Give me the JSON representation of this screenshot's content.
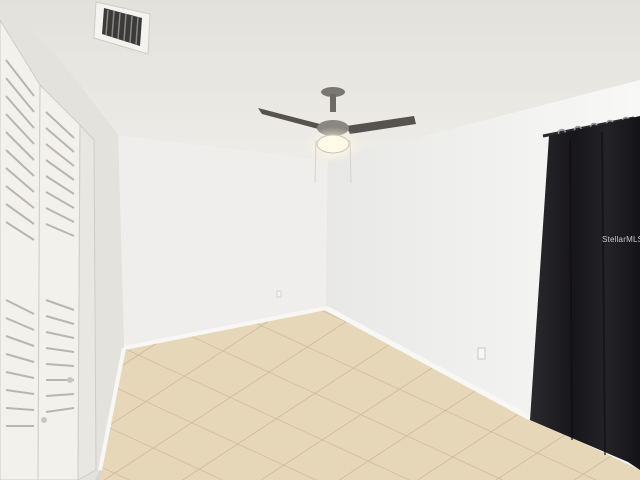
{
  "scene": {
    "description_free": true,
    "colors": {
      "ceiling": "#e9e7e2",
      "back_wall": "#efeeec",
      "right_wall": "#f3f3f2",
      "left_wall": "#e4e2dd",
      "floor": "#e6d7b8",
      "grout": "#c9b896",
      "baseboard": "#f7f7f5",
      "curtain": "#1d1c20",
      "fan": "#6d6a66",
      "light": "#fffbe8",
      "closet_door": "#f2f1ec"
    },
    "icons": [
      "ceiling-fan-icon",
      "air-vent-icon",
      "closet-louver-door-icon",
      "curtain-icon",
      "outlet-icon"
    ]
  },
  "watermark": {
    "text": "StellarMLS"
  }
}
